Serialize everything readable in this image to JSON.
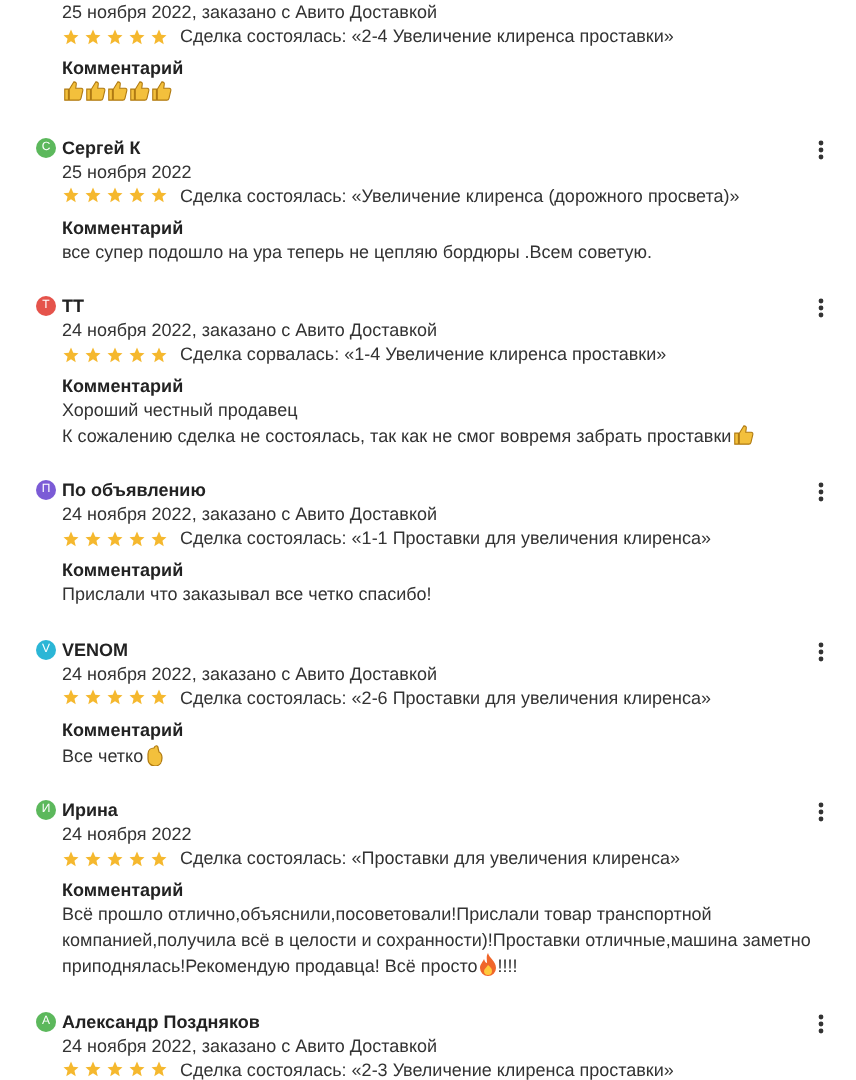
{
  "reviews": [
    {
      "date": "25 ноября 2022, заказано с Авито Доставкой",
      "stars": 5,
      "deal": "Сделка состоялась: «2-4 Увеличение клиренса проставки»",
      "comment_label": "Комментарий",
      "comment": [
        [
          {
            "kind": "thumb"
          },
          {
            "kind": "thumb"
          },
          {
            "kind": "thumb"
          },
          {
            "kind": "thumb"
          },
          {
            "kind": "thumb"
          }
        ]
      ]
    },
    {
      "avatar": "С",
      "color": "#5cb85c",
      "name": "Сергей К",
      "date": "25 ноября 2022",
      "stars": 5,
      "deal": "Сделка состоялась: «Увеличение клиренса (дорожного просвета)»",
      "comment_label": "Комментарий",
      "comment": [
        [
          {
            "kind": "text",
            "text": "все супер подошло на ура теперь не цепляю бордюры .Всем советую."
          }
        ]
      ]
    },
    {
      "avatar": "Т",
      "color": "#e5534b",
      "name": "ТТ",
      "date": "24 ноября 2022, заказано с Авито Доставкой",
      "stars": 5,
      "deal": "Сделка сорвалась: «1-4 Увеличение клиренса проставки»",
      "comment_label": "Комментарий",
      "comment": [
        [
          {
            "kind": "text",
            "text": "Хороший честный продавец"
          }
        ],
        [
          {
            "kind": "text",
            "text": "К сожалению сделка не состоялась, так как не смог вовремя забрать проставки"
          },
          {
            "kind": "thumb"
          }
        ]
      ]
    },
    {
      "avatar": "П",
      "color": "#7b5bd6",
      "name": "По объявлению",
      "date": "24 ноября 2022, заказано с Авито Доставкой",
      "stars": 5,
      "deal": "Сделка состоялась: «1-1 Проставки для увеличения клиренса»",
      "comment_label": "Комментарий",
      "comment": [
        [
          {
            "kind": "text",
            "text": "Прислали что заказывал все четко спасибо!"
          }
        ]
      ]
    },
    {
      "avatar": "V",
      "color": "#2bb6d6",
      "name": "VENOM",
      "date": "24 ноября 2022, заказано с Авито Доставкой",
      "stars": 5,
      "deal": "Сделка состоялась: «2-6 Проставки для увеличения клиренса»",
      "comment_label": "Комментарий",
      "comment": [
        [
          {
            "kind": "text",
            "text": "Все четко"
          },
          {
            "kind": "ok"
          }
        ]
      ]
    },
    {
      "avatar": "И",
      "color": "#5cb85c",
      "name": "Ирина",
      "date": "24 ноября 2022",
      "stars": 5,
      "deal": "Сделка состоялась: «Проставки для увеличения клиренса»",
      "comment_label": "Комментарий",
      "comment": [
        [
          {
            "kind": "text",
            "text": "Всё прошло отлично,объяснили,посоветовали!Прислали товар транспортной компанией,получила всё в целости и сохранности)!Проставки отличные,машина заметно приподнялась!Рекомендую продавца! Всё просто"
          },
          {
            "kind": "fire"
          },
          {
            "kind": "text",
            "text": "!!!!"
          }
        ]
      ]
    },
    {
      "avatar": "А",
      "color": "#5cb85c",
      "name": "Александр Поздняков",
      "date": "24 ноября 2022, заказано с Авито Доставкой",
      "stars": 5,
      "deal": "Сделка состоялась: «2-3 Увеличение клиренса проставки»"
    }
  ]
}
